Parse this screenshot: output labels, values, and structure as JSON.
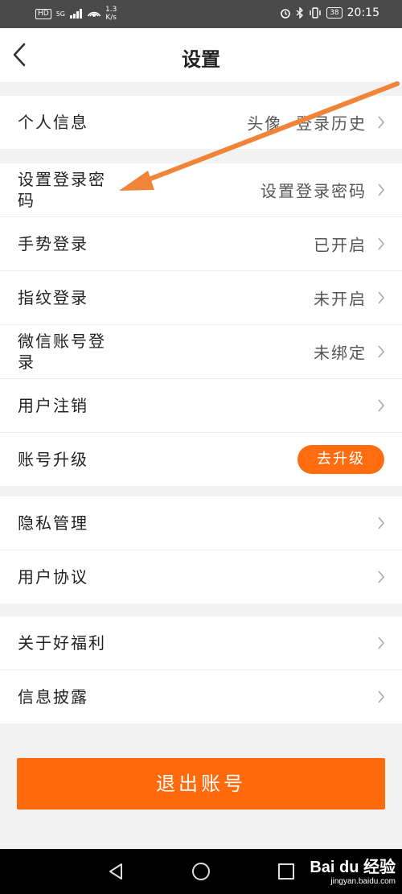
{
  "status_bar": {
    "hd": "HD",
    "network": "5G",
    "speed_value": "1.3",
    "speed_unit": "K/s",
    "battery": "38",
    "time": "20:15"
  },
  "header": {
    "title": "设置"
  },
  "sections": [
    {
      "rows": [
        {
          "label": "个人信息",
          "value": "头像  登录历史",
          "type": "link"
        }
      ]
    },
    {
      "rows": [
        {
          "label": "设置登录密码",
          "value": "设置登录密码",
          "type": "link"
        },
        {
          "label": "手势登录",
          "value": "已开启",
          "type": "link"
        },
        {
          "label": "指纹登录",
          "value": "未开启",
          "type": "link"
        },
        {
          "label": "微信账号登录",
          "value": "未绑定",
          "type": "link"
        },
        {
          "label": "用户注销",
          "value": "",
          "type": "link"
        },
        {
          "label": "账号升级",
          "button": "去升级",
          "type": "button"
        }
      ]
    },
    {
      "rows": [
        {
          "label": "隐私管理",
          "value": "",
          "type": "link"
        },
        {
          "label": "用户协议",
          "value": "",
          "type": "link"
        }
      ]
    },
    {
      "rows": [
        {
          "label": "关于好福利",
          "value": "",
          "type": "link"
        },
        {
          "label": "信息披露",
          "value": "",
          "type": "link"
        }
      ]
    }
  ],
  "logout": {
    "label": "退出账号"
  },
  "watermark": {
    "main": "Bai du 经验",
    "sub": "jingyan.baidu.com"
  },
  "colors": {
    "accent": "#ff6a0d",
    "annotation_arrow": "#f0853a",
    "background": "#f2f2f2"
  }
}
